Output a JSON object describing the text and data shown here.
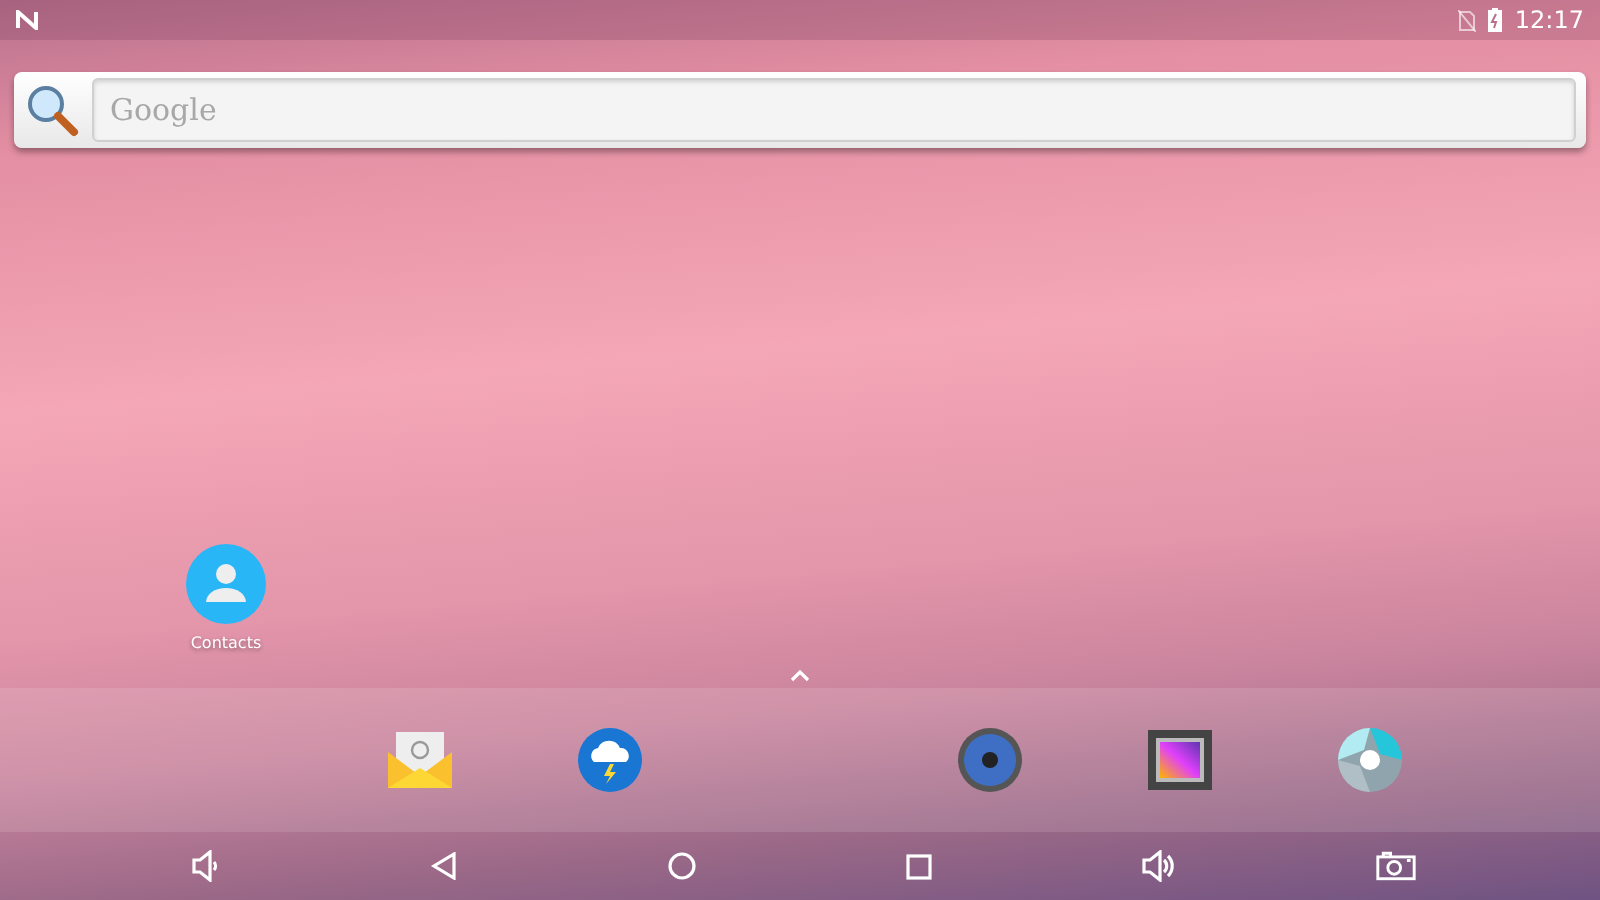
{
  "status_bar": {
    "time": "12:17"
  },
  "search": {
    "placeholder": "Google"
  },
  "desktop_icons": [
    {
      "label": "Contacts",
      "kind": "contacts"
    }
  ],
  "dock": [
    {
      "kind": "email"
    },
    {
      "kind": "weather"
    },
    {
      "kind": "music"
    },
    {
      "kind": "gallery"
    },
    {
      "kind": "camera"
    }
  ],
  "nav_buttons": [
    {
      "kind": "volume-down"
    },
    {
      "kind": "back"
    },
    {
      "kind": "home"
    },
    {
      "kind": "recents"
    },
    {
      "kind": "volume-up"
    },
    {
      "kind": "screenshot"
    }
  ]
}
